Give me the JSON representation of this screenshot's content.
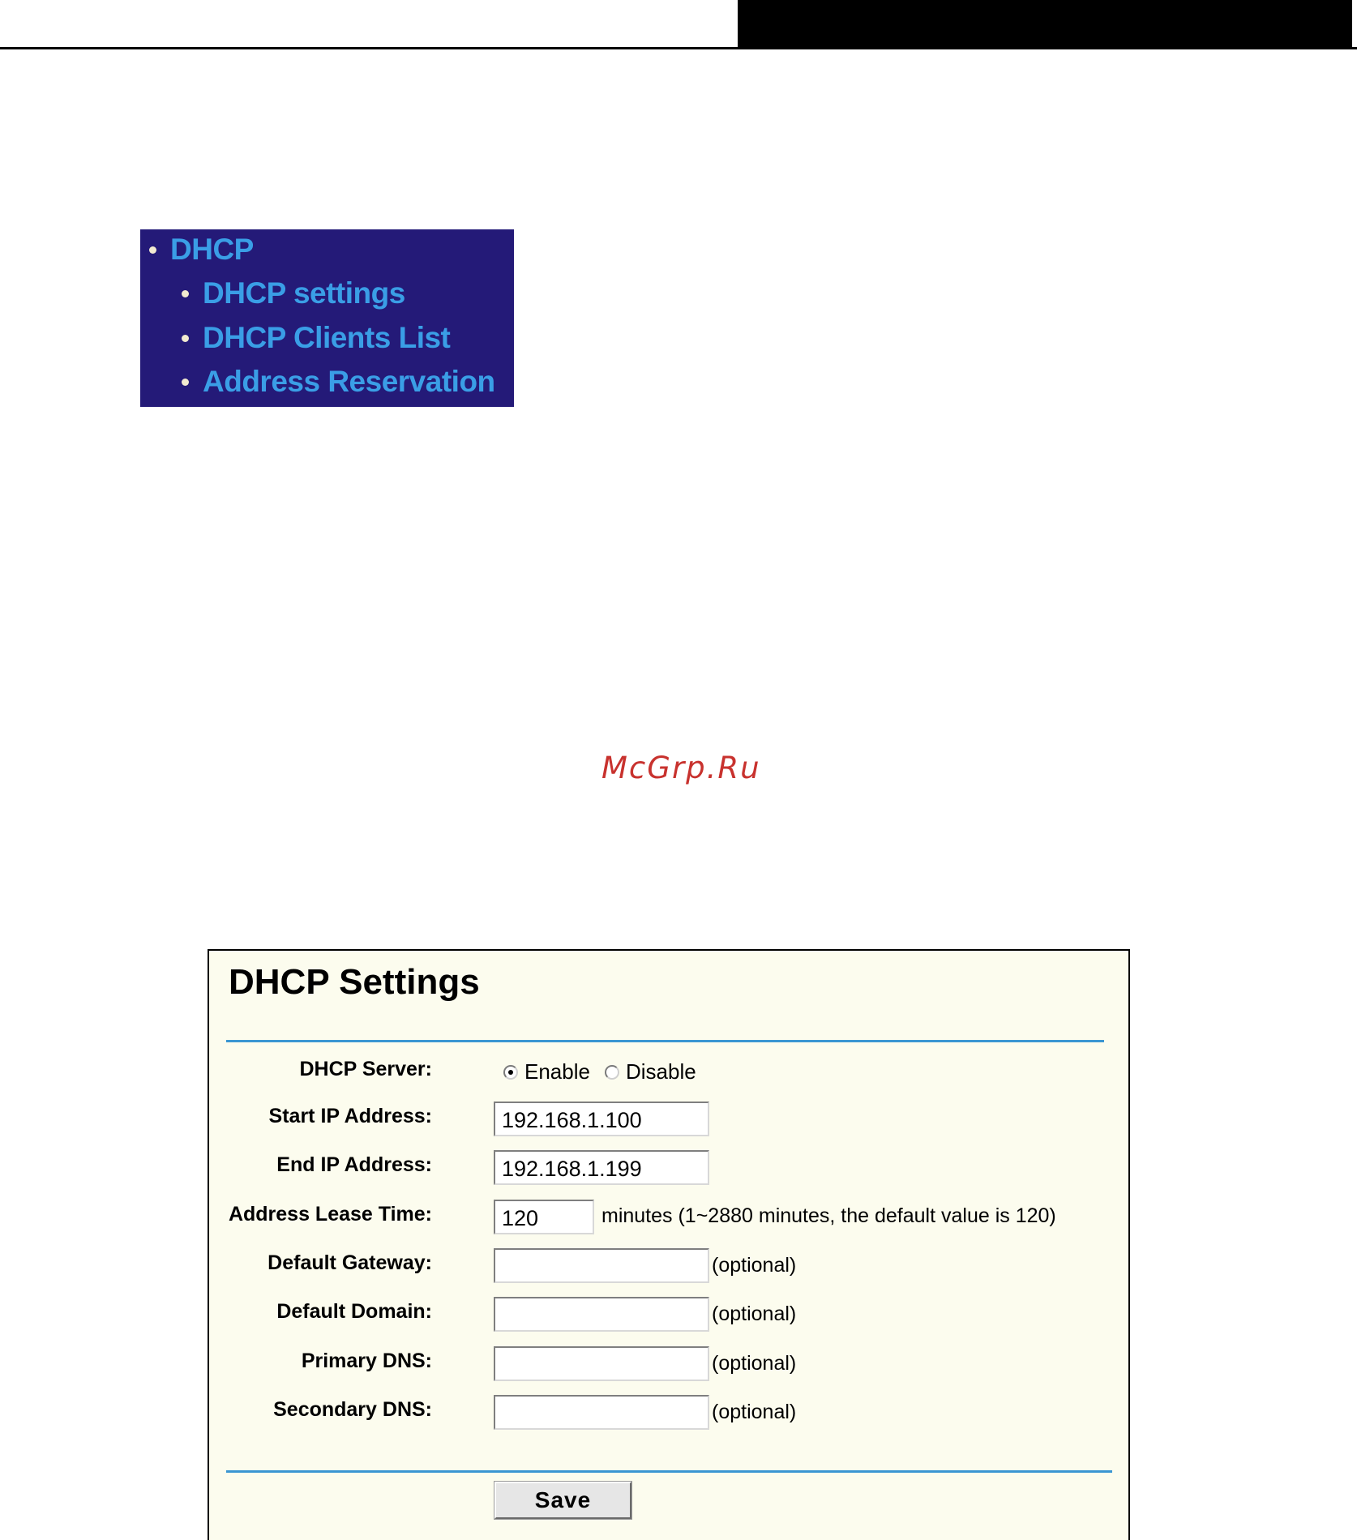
{
  "menu": {
    "items": [
      {
        "label": "DHCP"
      },
      {
        "label": "DHCP settings"
      },
      {
        "label": "DHCP Clients List"
      },
      {
        "label": "Address Reservation"
      }
    ],
    "colors": {
      "background": "#241a78",
      "text": "#3a9ee6",
      "bullet": "#f2ead0"
    }
  },
  "watermark": "McGrp.Ru",
  "panel": {
    "title": "DHCP Settings",
    "dhcp_server": {
      "label": "DHCP Server:",
      "options": [
        "Enable",
        "Disable"
      ],
      "selected": "Enable"
    },
    "start_ip": {
      "label": "Start IP Address:",
      "value": "192.168.1.100"
    },
    "end_ip": {
      "label": "End IP Address:",
      "value": "192.168.1.199"
    },
    "lease_time": {
      "label": "Address Lease Time:",
      "value": "120",
      "hint": "minutes (1~2880 minutes, the default value is 120)"
    },
    "default_gateway": {
      "label": "Default Gateway:",
      "value": "",
      "note": "(optional)"
    },
    "default_domain": {
      "label": "Default Domain:",
      "value": "",
      "note": "(optional)"
    },
    "primary_dns": {
      "label": "Primary DNS:",
      "value": "",
      "note": "(optional)"
    },
    "secondary_dns": {
      "label": "Secondary DNS:",
      "value": "",
      "note": "(optional)"
    },
    "save_label": "Save",
    "colors": {
      "background": "#fcfcee",
      "divider": "#3a96d2"
    }
  }
}
